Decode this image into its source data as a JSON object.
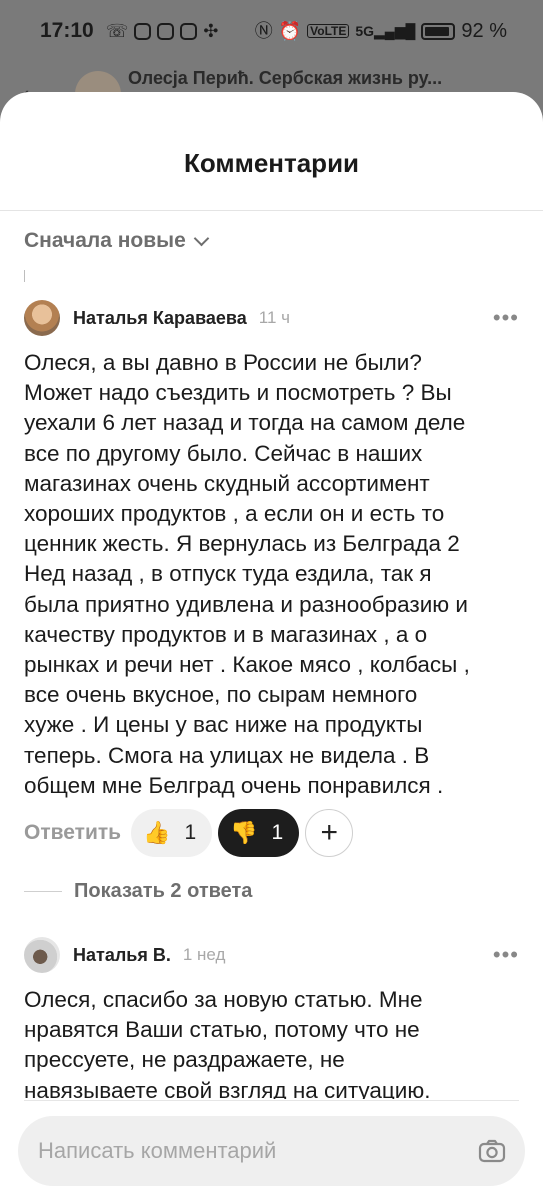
{
  "status_bar": {
    "time": "17:10",
    "battery_percent": "92 %",
    "battery_level": 0.92,
    "icons": [
      "call-icon",
      "instagram-icon",
      "instagram-icon",
      "instagram-icon",
      "pinwheel-icon",
      "nfc-icon",
      "alarm-icon",
      "volte-icon",
      "5g-signal-icon",
      "battery-icon"
    ]
  },
  "background_page": {
    "title": "Олесја Перић. Сербская жизнь ру..."
  },
  "sheet": {
    "title": "Комментарии",
    "sort_label": "Сначала новые"
  },
  "comments": [
    {
      "author": "Наталья Караваева",
      "time": "11 ч",
      "lines": [
        "Олеся, а вы давно в России не были?",
        "Может надо съездить и посмотреть ? Вы",
        "уехали 6 лет назад и тогда на самом деле",
        "все по другому было. Сейчас в наших",
        "магазинах очень скудный ассортимент",
        "хороших продуктов , а если он и есть то",
        "ценник жесть. Я вернулась из Белграда 2",
        "Нед назад , в отпуск туда ездила, так я",
        "была приятно удивлена и разнообразию и",
        "качеству продуктов и в магазинах , а о",
        "рынках и речи нет . Какое мясо , колбасы ,",
        "все очень вкусное, по сырам немного",
        "хуже .  И цены у вас ниже на продукты",
        "теперь. Смога на улицах не видела . В",
        "общем мне Белград очень понравился ."
      ],
      "reply_label": "Ответить",
      "likes": "1",
      "dislikes": "1",
      "show_replies_label": "Показать 2 ответа"
    },
    {
      "author": "Наталья В.",
      "time": "1 нед",
      "lines": [
        "Олеся, спасибо за новую статью. Мне",
        "нравятся Ваши статью, потому что не",
        "прессуете, не раздражаете, не",
        "навязываете свой взгляд на ситуацию."
      ]
    }
  ],
  "composer": {
    "placeholder": "Написать комментарий"
  }
}
